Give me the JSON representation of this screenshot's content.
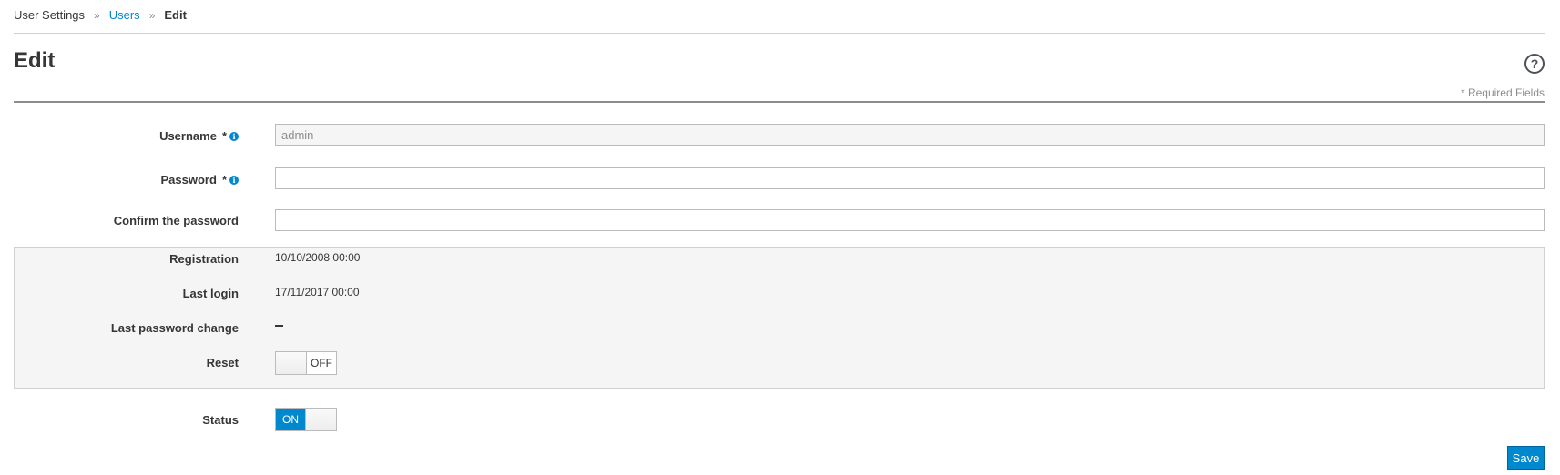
{
  "breadcrumb": {
    "root": "User Settings",
    "users": "Users",
    "current": "Edit",
    "separator": "»"
  },
  "header": {
    "title": "Edit",
    "help_icon": "?",
    "required_note": "* Required Fields"
  },
  "form": {
    "username": {
      "label": "Username",
      "required_mark": "*",
      "value": "admin",
      "info_icon": "i"
    },
    "password": {
      "label": "Password",
      "required_mark": "*",
      "value": "",
      "info_icon": "i"
    },
    "confirm_password": {
      "label": "Confirm the password",
      "value": ""
    }
  },
  "info": {
    "registration": {
      "label": "Registration",
      "value": "10/10/2008 00:00"
    },
    "last_login": {
      "label": "Last login",
      "value": "17/11/2017 00:00"
    },
    "last_password_change": {
      "label": "Last password change"
    },
    "reset": {
      "label": "Reset",
      "state": "OFF"
    }
  },
  "status": {
    "label": "Status",
    "state": "ON"
  },
  "actions": {
    "save_label": "Save"
  },
  "colors": {
    "accent": "#0088ce",
    "panel_bg": "#f5f5f5"
  }
}
